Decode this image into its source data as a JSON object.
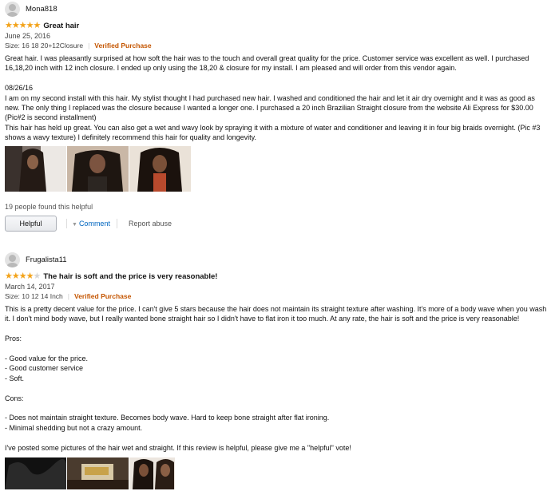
{
  "reviews": [
    {
      "author": "Mona818",
      "rating": 5,
      "title": "Great hair",
      "date": "June 25, 2016",
      "size": "Size: 16 18 20+12Closure",
      "verified": "Verified Purchase",
      "body": [
        "Great hair. I was pleasantly surprised at how soft the hair was to the touch and overall great quality for the price. Customer service was excellent as well. I purchased 16,18,20 inch with 12 inch closure. I ended up only using the 18,20 & closure for my install. I am pleased and will order from this vendor again.",
        "",
        "08/26/16",
        "I am on my second install with this hair. My stylist thought I had purchased new hair. I washed and conditioned the hair and let it air dry overnight and it was as good as new. The only thing I replaced was the closure because I wanted a longer one. I purchased a 20 inch Brazilian Straight closure from the website Ali Express for $30.00 (Pic#2 is second installment)",
        "This hair has held up great. You can also get a wet and wavy look by spraying it with a mixture of water and conditioner and leaving it in four big braids overnight. (Pic #3 shows a wavy texture) I definitely recommend this hair for quality and longevity."
      ],
      "helpful_count": "19 people found this helpful",
      "helpful_button": "Helpful",
      "comment_link": "Comment",
      "report_link": "Report abuse"
    },
    {
      "author": "Frugalista11",
      "rating": 4,
      "title": "The hair is soft and the price is very reasonable!",
      "date": "March 14, 2017",
      "size": "Size: 10 12 14 Inch",
      "verified": "Verified Purchase",
      "body": [
        "This is a pretty decent value for the price. I can't give 5 stars because the hair does not maintain its straight texture after washing. It's more of a body wave when you wash it. I don't mind body wave, but I really wanted bone straight hair so I didn't have to flat iron it too much. At any rate, the hair is soft and the price is very reasonable!",
        "",
        "Pros:",
        "",
        "- Good value for the price.",
        "- Good customer service",
        "- Soft.",
        "",
        "Cons:",
        "",
        "- Does not maintain straight texture. Becomes body wave. Hard to keep bone straight after flat ironing.",
        "- Minimal shedding but not a crazy amount.",
        "",
        "I've posted some pictures of the hair wet and straight. If this review is helpful, please give me a \"helpful\" vote!"
      ]
    }
  ],
  "colors": {
    "star": "#f3a31a",
    "verified": "#c45500",
    "link": "#0066c0"
  }
}
